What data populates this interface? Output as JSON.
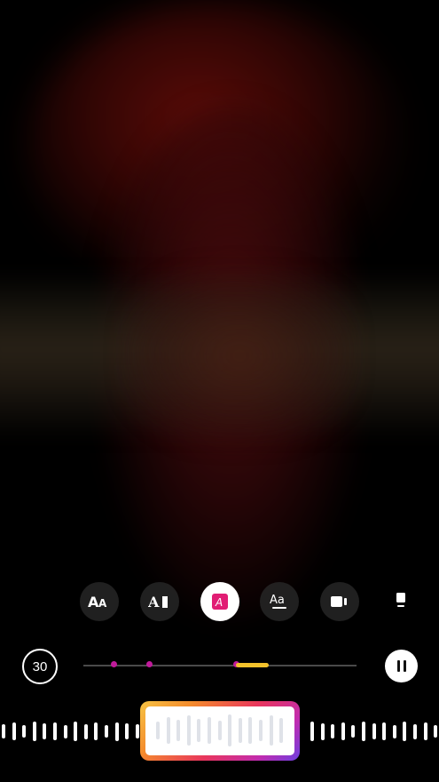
{
  "editor": {
    "duration_label": "30",
    "tools": [
      {
        "name": "text-size-icon",
        "active": false
      },
      {
        "name": "text-align-icon",
        "active": false
      },
      {
        "name": "text-style-icon",
        "active": true
      },
      {
        "name": "text-underline-icon",
        "active": false
      },
      {
        "name": "video-icon",
        "active": false
      },
      {
        "name": "card-icon",
        "active": false
      }
    ],
    "playback": {
      "state": "playing",
      "selection_start_fraction": 0.56,
      "selection_end_fraction": 0.68,
      "marker_fractions": [
        0.11,
        0.24,
        0.56
      ]
    },
    "colors": {
      "accent_pink": "#e11d74",
      "marker": "#c01b9b",
      "selection": "#f4c22b"
    }
  }
}
